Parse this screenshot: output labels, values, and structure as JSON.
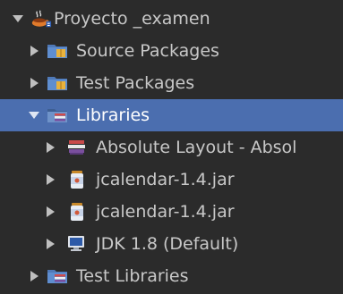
{
  "tree": {
    "project": {
      "label": "Proyecto _examen",
      "icon": "coffee-cup-project-icon",
      "expanded": true
    },
    "source_packages": {
      "label": "Source Packages",
      "icon": "package-folder-icon",
      "expanded": false
    },
    "test_packages": {
      "label": "Test Packages",
      "icon": "package-folder-icon",
      "expanded": false
    },
    "libraries": {
      "label": "Libraries",
      "icon": "library-folder-icon",
      "expanded": true,
      "selected": true,
      "items": [
        {
          "label": "Absolute Layout - Absol",
          "icon": "books-icon"
        },
        {
          "label": "jcalendar-1.4.jar",
          "icon": "jar-icon"
        },
        {
          "label": "jcalendar-1.4.jar",
          "icon": "jar-icon"
        },
        {
          "label": "JDK 1.8 (Default)",
          "icon": "monitor-icon"
        }
      ]
    },
    "test_libraries": {
      "label": "Test Libraries",
      "icon": "library-folder-icon",
      "expanded": false
    }
  },
  "colors": {
    "background": "#2b2b2b",
    "text": "#c8c8c8",
    "selection": "#4b6eaf"
  }
}
